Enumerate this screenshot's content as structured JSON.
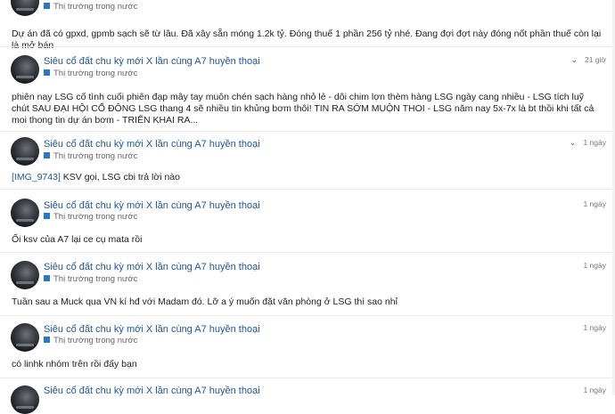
{
  "posts": [
    {
      "author": "",
      "category": "Thị trường trong nước",
      "time": "",
      "tag": "",
      "body": "Dự án đã có gpxd, gpmb sạch sẽ từ lâu. Đã xây sẵn móng 1.2k tỷ. Đóng thuế 1 phần 256 tỷ nhé. Đang đợi đợt này đóng nốt phần thuế còn lại là mở bán"
    },
    {
      "author": "Siêu cổ đất chu kỳ mới X lần cùng A7 huyền thoại",
      "category": "Thị trường trong nước",
      "time": "21 giờ",
      "tag": "",
      "body": "phiên nay LSG cố tình cuối phiên đạp mây tay muôn chén sạch hàng nhỏ lẻ - dôi chim lợn thèm hàng LSG ngày cang nhiều - LSG tích luỹ chút SAU ĐẠI HỘI CỔ ĐÔNG LSG thang 4 sẽ nhiều tin khủng bơm thôi! TIN RA SỚM MUỘN THOI - LSG năm nay 5x-7x là bt thồi khi tất cả moi thong tin dự án bơm - TRIỂN KHAI RA..."
    },
    {
      "author": "Siêu cổ đất chu kỳ mới X lần cùng A7 huyền thoại",
      "category": "Thị trường trong nước",
      "time": "1 ngày",
      "tag": "[IMG_9743]",
      "body": " KSV gọi, LSG cbi trả lời nào"
    },
    {
      "author": "Siêu cổ đất chu kỳ mới X lần cùng A7 huyền thoại",
      "category": "Thị trường trong nước",
      "time": "1 ngày",
      "tag": "",
      "body": "Ối ksv của A7 lại ce cụ mata rồi"
    },
    {
      "author": "Siêu cổ đất chu kỳ mới X lần cùng A7 huyền thoại",
      "category": "Thị trường trong nước",
      "time": "1 ngày",
      "tag": "",
      "body": "Tuần sau a Muck qua VN kí hđ với Madam đó. Lỡ a ý muốn đặt văn phòng ở LSG thì sao nhỉ"
    },
    {
      "author": "Siêu cổ đất chu kỳ mới X lần cùng A7 huyền thoại",
      "category": "Thị trường trong nước",
      "time": "1 ngày",
      "tag": "",
      "body": "có linhk nhóm trên rồi đấy bạn"
    },
    {
      "author": "Siêu cổ đất chu kỳ mới X lần cùng A7 huyền thoại",
      "category": "",
      "time": "1 ngày",
      "tag": "",
      "body": ""
    }
  ],
  "icons": {
    "expand": "chevron-down-icon",
    "category": "category-square-icon"
  },
  "colors": {
    "author": "#1f5599",
    "category_square": "#2a77c4",
    "divider": "#e9e9e9"
  }
}
